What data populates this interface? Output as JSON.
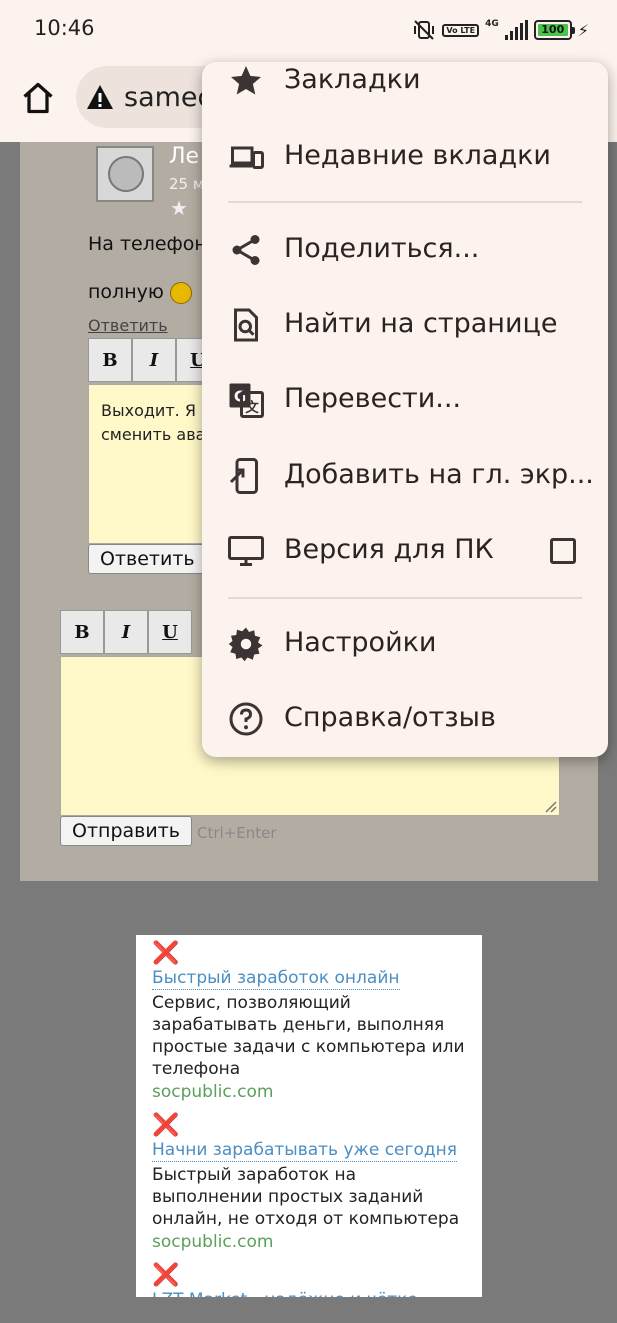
{
  "status_bar": {
    "time": "10:46",
    "network": "4G",
    "volte": "Vo LTE",
    "battery": "100"
  },
  "browser": {
    "url_text": "samec"
  },
  "page": {
    "comment": {
      "author_initial": "Ле",
      "date_fragment": "25 м",
      "text_line1": "На телефон",
      "text_line2": "полную",
      "reply_link": "Ответить"
    },
    "reply_editor": {
      "bold": "B",
      "italic": "I",
      "underline": "U",
      "text_line1": "Выходит. Я",
      "text_line2": "сменить ава",
      "submit": "Ответить"
    },
    "main_editor": {
      "bold": "B",
      "italic": "I",
      "underline": "U",
      "submit": "Отправить",
      "hint": "Ctrl+Enter"
    }
  },
  "ad": {
    "items": [
      {
        "close": "❌",
        "title": "Быстрый заработок онлайн",
        "description": "Сервис, позволяющий зарабатывать деньги, выполняя простые задачи с компьютера или телефона",
        "domain": "socpublic.com"
      },
      {
        "close": "❌",
        "title": "Начни зарабатывать уже сегодня",
        "description": "Быстрый заработок на выполнении простых заданий онлайн, не отходя от компьютера",
        "domain": "socpublic.com"
      },
      {
        "close": "❌",
        "title": "LZT Market - надёжно и чётко",
        "description": "",
        "domain": ""
      }
    ]
  },
  "menu": {
    "items": [
      {
        "label": "Закладки",
        "icon": "star-icon"
      },
      {
        "label": "Недавние вкладки",
        "icon": "devices-icon"
      },
      {
        "label": "Поделиться...",
        "icon": "share-icon"
      },
      {
        "label": "Найти на странице",
        "icon": "find-in-page-icon"
      },
      {
        "label": "Перевести...",
        "icon": "translate-icon"
      },
      {
        "label": "Добавить на гл. экр...",
        "icon": "add-to-home-icon"
      },
      {
        "label": "Версия для ПК",
        "icon": "desktop-icon"
      },
      {
        "label": "Настройки",
        "icon": "gear-icon"
      },
      {
        "label": "Справка/отзыв",
        "icon": "help-icon"
      }
    ]
  },
  "colors": {
    "menu_bg": "#fdf3ee",
    "page_bg": "#b3aca2",
    "ad_link": "#4b8ec4",
    "ad_domain": "#5aa05a"
  }
}
